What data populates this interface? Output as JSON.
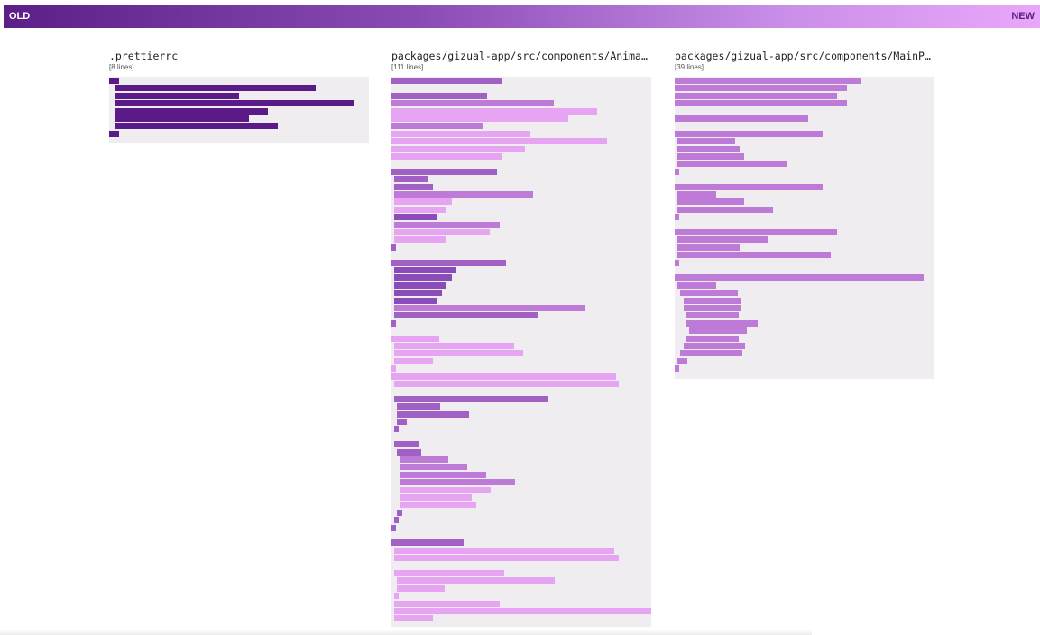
{
  "header": {
    "old_label": "OLD",
    "new_label": "NEW",
    "gradient_colors": [
      "#5c1f87",
      "#8a4bb5",
      "#c98ee8",
      "#e9a7f9"
    ]
  },
  "files": [
    {
      "name": ".prettierrc",
      "line_count": "[8 lines]",
      "lines": [
        {
          "indent": 0,
          "length": 2,
          "age": "oldest"
        },
        {
          "indent": 2,
          "length": 42,
          "age": "oldest"
        },
        {
          "indent": 2,
          "length": 26,
          "age": "oldest"
        },
        {
          "indent": 2,
          "length": 50,
          "age": "oldest"
        },
        {
          "indent": 2,
          "length": 32,
          "age": "oldest"
        },
        {
          "indent": 2,
          "length": 28,
          "age": "oldest"
        },
        {
          "indent": 2,
          "length": 34,
          "age": "oldest"
        },
        {
          "indent": 0,
          "length": 2,
          "age": "oldest"
        }
      ]
    },
    {
      "name": "packages/gizual-app/src/components/AnimatedFileTree.tsx",
      "line_count": "[111 lines]",
      "lines": [
        {
          "indent": 0,
          "length": 23,
          "age": "mid"
        },
        {
          "gap": true
        },
        {
          "indent": 0,
          "length": 20,
          "age": "mid"
        },
        {
          "indent": 0,
          "length": 34,
          "age": "light"
        },
        {
          "indent": 0,
          "length": 43,
          "age": "pale"
        },
        {
          "indent": 0,
          "length": 37,
          "age": "pale"
        },
        {
          "indent": 0,
          "length": 19,
          "age": "light"
        },
        {
          "indent": 0,
          "length": 29,
          "age": "pale"
        },
        {
          "indent": 0,
          "length": 45,
          "age": "pale"
        },
        {
          "indent": 0,
          "length": 28,
          "age": "pale"
        },
        {
          "indent": 0,
          "length": 23,
          "age": "pale"
        },
        {
          "gap": true
        },
        {
          "indent": 0,
          "length": 22,
          "age": "mid"
        },
        {
          "indent": 1,
          "length": 7,
          "age": "mid"
        },
        {
          "indent": 1,
          "length": 8,
          "age": "mid"
        },
        {
          "indent": 1,
          "length": 29,
          "age": "light"
        },
        {
          "indent": 1,
          "length": 12,
          "age": "pale"
        },
        {
          "indent": 1,
          "length": 11,
          "age": "pale"
        },
        {
          "indent": 1,
          "length": 9,
          "age": "dark"
        },
        {
          "indent": 1,
          "length": 22,
          "age": "light"
        },
        {
          "indent": 1,
          "length": 20,
          "age": "pale"
        },
        {
          "indent": 1,
          "length": 11,
          "age": "pale"
        },
        {
          "indent": 0,
          "length": 1,
          "age": "mid"
        },
        {
          "gap": true
        },
        {
          "indent": 0,
          "length": 24,
          "age": "mid"
        },
        {
          "indent": 1,
          "length": 13,
          "age": "dark"
        },
        {
          "indent": 1,
          "length": 12,
          "age": "dark"
        },
        {
          "indent": 1,
          "length": 11,
          "age": "dark"
        },
        {
          "indent": 1,
          "length": 10,
          "age": "dark"
        },
        {
          "indent": 1,
          "length": 9,
          "age": "dark"
        },
        {
          "indent": 1,
          "length": 40,
          "age": "light"
        },
        {
          "indent": 1,
          "length": 30,
          "age": "mid"
        },
        {
          "indent": 0,
          "length": 1,
          "age": "mid"
        },
        {
          "gap": true
        },
        {
          "indent": 0,
          "length": 10,
          "age": "pale"
        },
        {
          "indent": 1,
          "length": 25,
          "age": "pale"
        },
        {
          "indent": 1,
          "length": 27,
          "age": "pale"
        },
        {
          "indent": 1,
          "length": 8,
          "age": "pale"
        },
        {
          "indent": 0,
          "length": 1,
          "age": "pale"
        },
        {
          "indent": 0,
          "length": 47,
          "age": "pale"
        },
        {
          "indent": 1,
          "length": 47,
          "age": "pale"
        },
        {
          "gap": true
        },
        {
          "indent": 1,
          "length": 32,
          "age": "mid"
        },
        {
          "indent": 2,
          "length": 9,
          "age": "mid"
        },
        {
          "indent": 2,
          "length": 15,
          "age": "mid"
        },
        {
          "indent": 2,
          "length": 2,
          "age": "mid"
        },
        {
          "indent": 1,
          "length": 1,
          "age": "mid"
        },
        {
          "gap": true
        },
        {
          "indent": 1,
          "length": 5,
          "age": "mid"
        },
        {
          "indent": 2,
          "length": 5,
          "age": "mid"
        },
        {
          "indent": 3,
          "length": 10,
          "age": "light"
        },
        {
          "indent": 3,
          "length": 14,
          "age": "light"
        },
        {
          "indent": 3,
          "length": 18,
          "age": "light"
        },
        {
          "indent": 3,
          "length": 24,
          "age": "light"
        },
        {
          "indent": 3,
          "length": 19,
          "age": "pale"
        },
        {
          "indent": 3,
          "length": 15,
          "age": "pale"
        },
        {
          "indent": 3,
          "length": 16,
          "age": "pale"
        },
        {
          "indent": 2,
          "length": 1,
          "age": "mid"
        },
        {
          "indent": 1,
          "length": 1,
          "age": "mid"
        },
        {
          "indent": 0,
          "length": 1,
          "age": "mid"
        },
        {
          "gap": true
        },
        {
          "indent": 0,
          "length": 15,
          "age": "mid"
        },
        {
          "indent": 1,
          "length": 46,
          "age": "pale"
        },
        {
          "indent": 1,
          "length": 47,
          "age": "pale"
        },
        {
          "gap": true
        },
        {
          "indent": 1,
          "length": 23,
          "age": "pale"
        },
        {
          "indent": 2,
          "length": 33,
          "age": "pale"
        },
        {
          "indent": 2,
          "length": 10,
          "age": "pale"
        },
        {
          "indent": 1,
          "length": 1,
          "age": "pale"
        },
        {
          "indent": 1,
          "length": 22,
          "age": "pale"
        },
        {
          "indent": 1,
          "length": 55,
          "age": "pale"
        },
        {
          "indent": 1,
          "length": 8,
          "age": "pale"
        }
      ]
    },
    {
      "name": "packages/gizual-app/src/components/MainPage.tsx",
      "line_count": "[39 lines]",
      "lines": [
        {
          "indent": 0,
          "length": 39,
          "age": "light"
        },
        {
          "indent": 0,
          "length": 36,
          "age": "light"
        },
        {
          "indent": 0,
          "length": 34,
          "age": "light"
        },
        {
          "indent": 0,
          "length": 36,
          "age": "light"
        },
        {
          "gap": true
        },
        {
          "indent": 0,
          "length": 28,
          "age": "light"
        },
        {
          "gap": true
        },
        {
          "indent": 0,
          "length": 31,
          "age": "light"
        },
        {
          "indent": 1,
          "length": 12,
          "age": "light"
        },
        {
          "indent": 1,
          "length": 13,
          "age": "light"
        },
        {
          "indent": 1,
          "length": 14,
          "age": "light"
        },
        {
          "indent": 1,
          "length": 23,
          "age": "light"
        },
        {
          "indent": 0,
          "length": 1,
          "age": "light"
        },
        {
          "gap": true
        },
        {
          "indent": 0,
          "length": 31,
          "age": "light"
        },
        {
          "indent": 1,
          "length": 8,
          "age": "light"
        },
        {
          "indent": 1,
          "length": 14,
          "age": "light"
        },
        {
          "indent": 1,
          "length": 20,
          "age": "light"
        },
        {
          "indent": 0,
          "length": 1,
          "age": "light"
        },
        {
          "gap": true
        },
        {
          "indent": 0,
          "length": 34,
          "age": "light"
        },
        {
          "indent": 1,
          "length": 19,
          "age": "light"
        },
        {
          "indent": 1,
          "length": 13,
          "age": "light"
        },
        {
          "indent": 1,
          "length": 32,
          "age": "light"
        },
        {
          "indent": 0,
          "length": 1,
          "age": "light"
        },
        {
          "gap": true
        },
        {
          "indent": 0,
          "length": 52,
          "age": "light"
        },
        {
          "indent": 1,
          "length": 8,
          "age": "light"
        },
        {
          "indent": 2,
          "length": 12,
          "age": "light"
        },
        {
          "indent": 3,
          "length": 12,
          "age": "light"
        },
        {
          "indent": 3,
          "length": 12,
          "age": "light"
        },
        {
          "indent": 4,
          "length": 11,
          "age": "light"
        },
        {
          "indent": 4,
          "length": 15,
          "age": "light"
        },
        {
          "indent": 5,
          "length": 12,
          "age": "light"
        },
        {
          "indent": 4,
          "length": 11,
          "age": "light"
        },
        {
          "indent": 3,
          "length": 13,
          "age": "light"
        },
        {
          "indent": 2,
          "length": 13,
          "age": "light"
        },
        {
          "indent": 1,
          "length": 2,
          "age": "light"
        },
        {
          "indent": 0,
          "length": 1,
          "age": "light"
        }
      ]
    }
  ],
  "age_colors": {
    "oldest": "#5a1a88",
    "dark": "#8a4cb8",
    "mid": "#a060c4",
    "light": "#bd7ad6",
    "pale": "#e6a4f2"
  }
}
